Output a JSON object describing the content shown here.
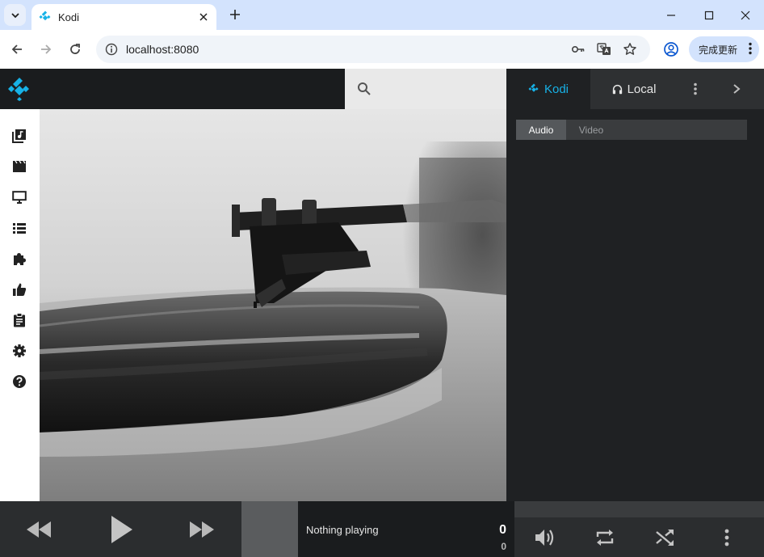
{
  "browser": {
    "tab": {
      "title": "Kodi"
    },
    "address": {
      "url": "localhost:8080"
    },
    "update_label": "完成更新"
  },
  "colors": {
    "accent": "#17b2e7",
    "header_dark": "#1a1c1e",
    "panel_dark": "#1f2123",
    "player_bar": "#2b2d2f",
    "search_bg": "#e9e9e9",
    "browser_frame": "#d3e3fd"
  },
  "sidebar": {
    "items": [
      {
        "icon": "library-music-icon"
      },
      {
        "icon": "movie-icon"
      },
      {
        "icon": "tv-icon"
      },
      {
        "icon": "playlist-icon"
      },
      {
        "icon": "addons-puzzle-icon"
      },
      {
        "icon": "thumbs-up-icon"
      },
      {
        "icon": "clipboard-icon"
      },
      {
        "icon": "settings-gear-icon"
      },
      {
        "icon": "help-icon"
      }
    ]
  },
  "right_panel": {
    "tabs": [
      {
        "label": "Kodi",
        "icon": "kodi-icon",
        "active": true
      },
      {
        "label": "Local",
        "icon": "headphones-icon",
        "active": false
      }
    ],
    "subtabs": [
      {
        "label": "Audio",
        "active": true
      },
      {
        "label": "Video",
        "active": false
      }
    ]
  },
  "player": {
    "now_playing": "Nothing playing",
    "time_main": "0",
    "time_sub": "0",
    "progress_fraction": 0
  }
}
